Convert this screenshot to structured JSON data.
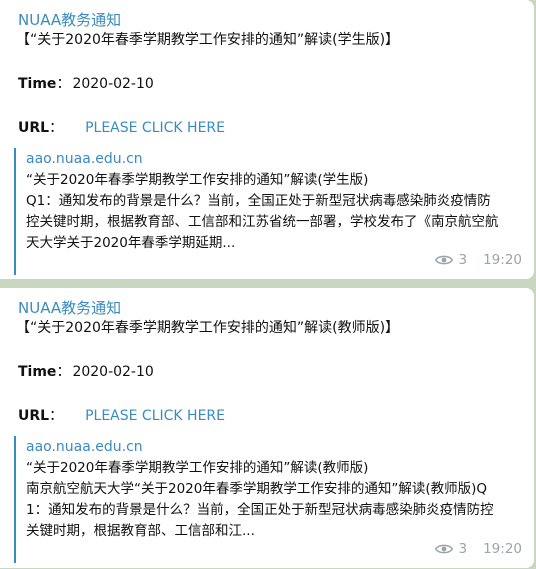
{
  "messages": [
    {
      "sender": "NUAA教务通知",
      "headline": "【“关于2020年春季学期教学工作安排的通知”解读(学生版)】",
      "time_label": "Time",
      "time_sep": "：",
      "time_value": "2020-02-10",
      "url_label": "URL",
      "url_sep": "：",
      "url_link": "PLEASE CLICK HERE",
      "preview": {
        "site": "aao.nuaa.edu.cn",
        "title": "“关于2020年春季学期教学工作安排的通知”解读(学生版)",
        "description": "Q1：通知发布的背景是什么？当前，全国正处于新型冠状病毒感染肺炎疫情防控关键时期，根据教育部、工信部和江苏省统一部署，学校发布了《南京航空航天大学关于2020年春季学期延期..."
      },
      "views": "3",
      "timestamp": "19:20"
    },
    {
      "sender": "NUAA教务通知",
      "headline": "【“关于2020年春季学期教学工作安排的通知”解读(教师版)】",
      "time_label": "Time",
      "time_sep": "：",
      "time_value": "2020-02-10",
      "url_label": "URL",
      "url_sep": "：",
      "url_link": "PLEASE CLICK HERE",
      "preview": {
        "site": "aao.nuaa.edu.cn",
        "title": "“关于2020年春季学期教学工作安排的通知”解读(教师版)",
        "description": "南京航空航天大学“关于2020年春季学期教学工作安排的通知”解读(教师版)Q1：通知发布的背景是什么？当前，全国正处于新型冠状病毒感染肺炎疫情防控关键时期，根据教育部、工信部和江..."
      },
      "views": "3",
      "timestamp": "19:20"
    }
  ],
  "icons": {
    "views": "eye-icon"
  },
  "colors": {
    "accent": "#3a8bbf",
    "meta": "#9aa5ab",
    "background": "#c9d6c0"
  }
}
